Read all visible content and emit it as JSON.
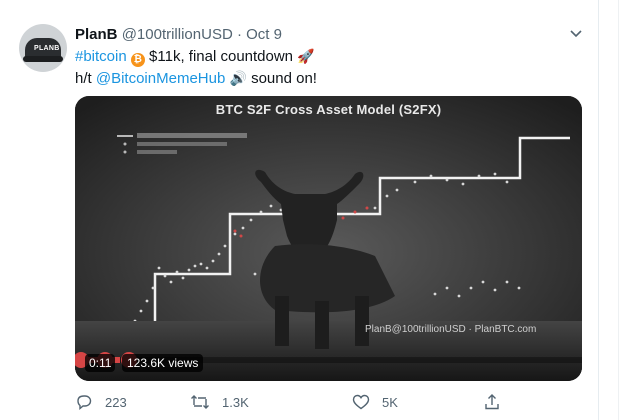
{
  "tweet": {
    "author_name": "PlanB",
    "handle": "@100trillionUSD",
    "separator": "·",
    "date": "Oct 9",
    "avatar_text": "PLANB",
    "line1": {
      "hashtag": "#bitcoin",
      "text": " $11k, final countdown "
    },
    "line2": {
      "prefix": "h/t ",
      "mention": "@BitcoinMemeHub",
      "suffix": " sound on!"
    },
    "icons": {
      "bitcoin": "bitcoin-icon",
      "rocket": "rocket-icon",
      "speaker": "speaker-icon",
      "caret": "chevron-down-icon"
    }
  },
  "media": {
    "title": "BTC S2F Cross Asset Model (S2FX)",
    "watermark": "PlanB@100trillionUSD · PlanBTC.com",
    "time": "0:11",
    "views": "123.6K views"
  },
  "actions": {
    "reply_count": "223",
    "retweet_count": "1.3K",
    "like_count": "5K"
  },
  "colors": {
    "link": "#1b95e0",
    "muted": "#536471",
    "bitcoin": "#f7931a"
  }
}
